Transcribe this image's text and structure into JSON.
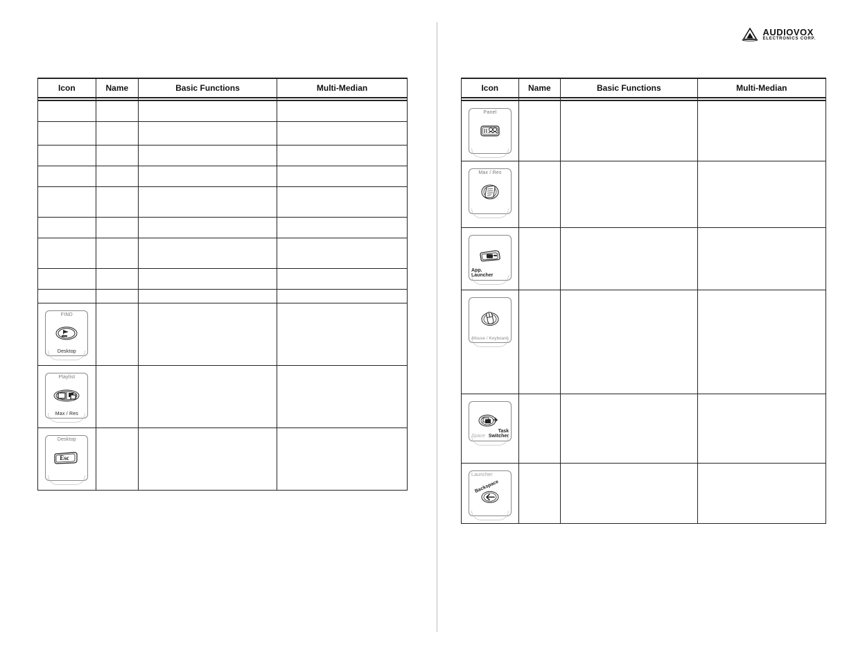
{
  "brand": {
    "name": "AUDIOVOX",
    "sub": "ELECTRONICS CORP."
  },
  "headers": {
    "icon": "Icon",
    "name": "Name",
    "func": "Basic Functions",
    "mm": "Multi-Median"
  },
  "left_icons": {
    "find": {
      "top": "FIND",
      "bot": "Desktop",
      "glyph": "flag"
    },
    "playlist": {
      "top": "Playlist",
      "bot": "Max / Res",
      "glyph": "maxres"
    },
    "desktop": {
      "top": "Desktop",
      "glyph": "esc",
      "esc": "Esc"
    }
  },
  "right_icons": {
    "panel": {
      "top": "Panel",
      "glyph": "panel"
    },
    "maxres": {
      "top": "Max / Res",
      "glyph": "doc"
    },
    "app": {
      "corner_bl": "App.\nLauncher",
      "glyph": "apps"
    },
    "mouse": {
      "bot": "Mouse / Keyboard",
      "glyph": "mouse"
    },
    "task": {
      "corner_br": "Task\nSwitcher",
      "corner_bl_light": "Space",
      "glyph": "task"
    },
    "back": {
      "diag": "Backspace",
      "top_light": "Launcher",
      "glyph": "back"
    }
  }
}
